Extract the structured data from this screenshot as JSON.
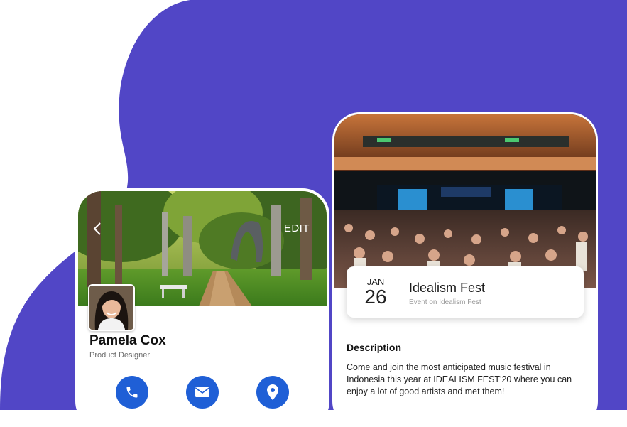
{
  "colors": {
    "background_blob": "#5146c6",
    "accent": "#1f5fd6"
  },
  "profile": {
    "back_icon": "chevron-left-icon",
    "edit_label": "EDIT",
    "name": "Pamela Cox",
    "role": "Product Designer",
    "actions": [
      {
        "icon": "phone-icon"
      },
      {
        "icon": "mail-icon"
      },
      {
        "icon": "location-pin-icon"
      }
    ]
  },
  "event": {
    "month": "JAN",
    "day": "26",
    "title": "Idealism Fest",
    "subtitle": "Event on Idealism Fest",
    "description_heading": "Description",
    "description": "Come and join the most anticipated music festival in Indonesia this year at IDEALISM FEST'20 where you can enjoy a lot of good artists and met them!"
  }
}
